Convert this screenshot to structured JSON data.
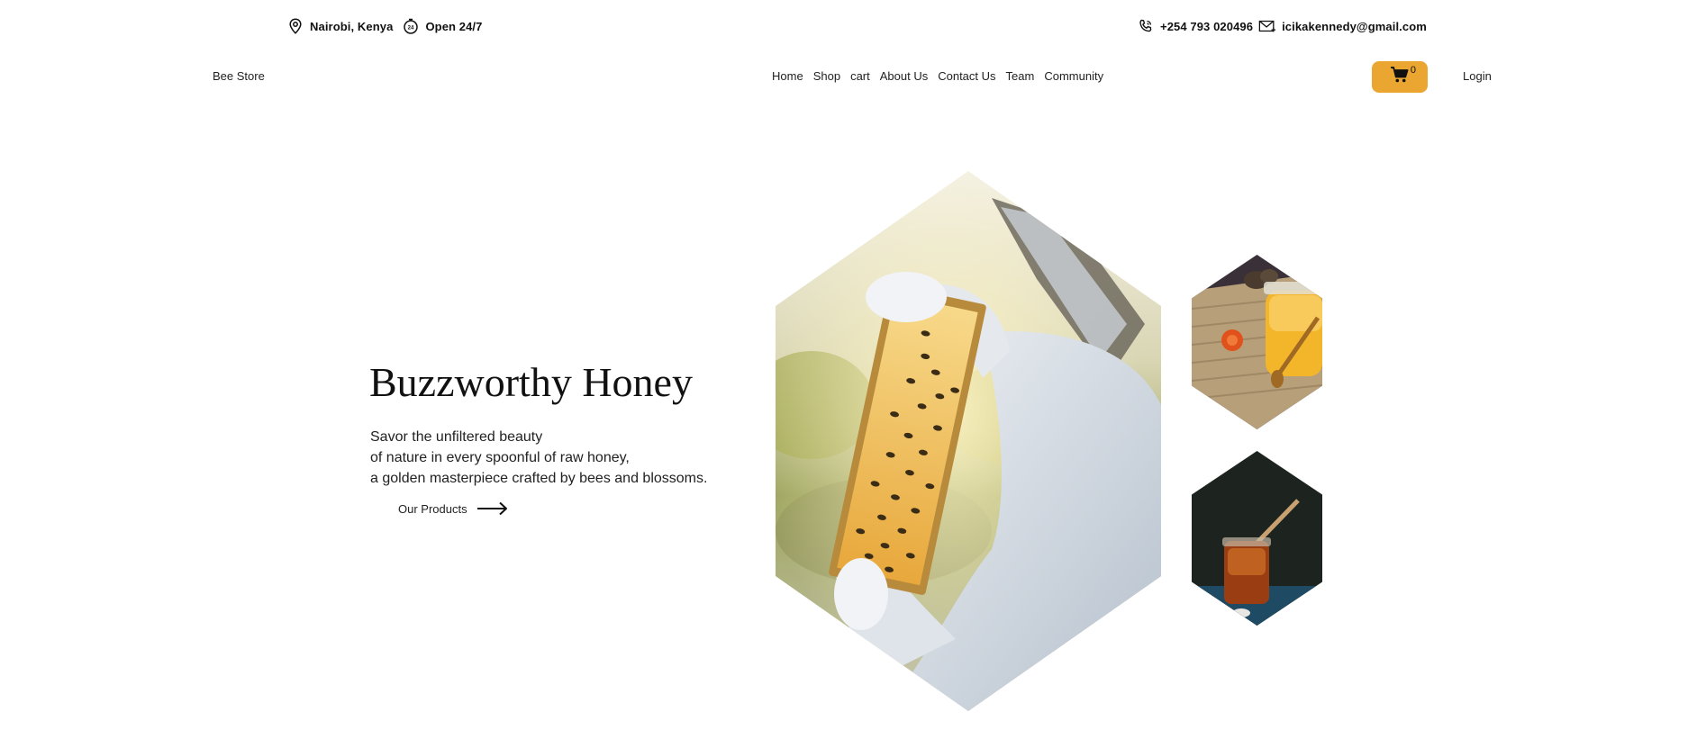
{
  "topbar": {
    "location": "Nairobi, Kenya",
    "hours": "Open 24/7",
    "phone": "+254 793 020496",
    "email": "icikakennedy@gmail.com",
    "icons": [
      "map-pin-icon",
      "clock-24-icon",
      "phone-icon",
      "mail-icon"
    ]
  },
  "navbar": {
    "brand": "Bee Store",
    "links": [
      "Home",
      "Shop",
      "cart",
      "About Us",
      "Contact Us",
      "Team",
      "Community"
    ],
    "cart_count": "0",
    "login": "Login"
  },
  "hero": {
    "title": "Buzzworthy Honey",
    "description_lines": [
      "Savor the unfiltered beauty",
      "of nature in every spoonful of raw honey,",
      "a golden masterpiece crafted by bees and blossoms."
    ],
    "cta": "Our Products"
  },
  "colors": {
    "accent": "#eaa630",
    "text": "#111111",
    "background": "#ffffff"
  }
}
